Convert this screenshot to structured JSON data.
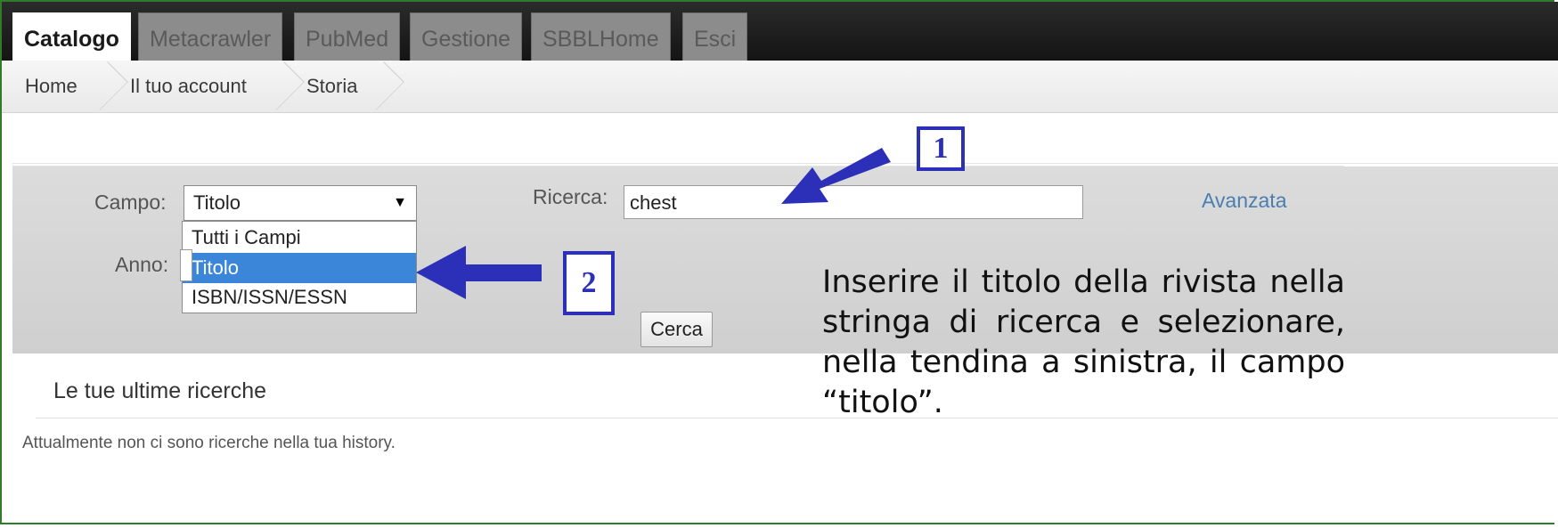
{
  "tabs": [
    {
      "label": "Catalogo",
      "active": true
    },
    {
      "label": "Metacrawler",
      "active": false
    },
    {
      "label": "PubMed",
      "active": false
    },
    {
      "label": "Gestione",
      "active": false
    },
    {
      "label": "SBBLHome",
      "active": false
    },
    {
      "label": "Esci",
      "active": false
    }
  ],
  "breadcrumb": [
    "Home",
    "Il tuo account",
    "Storia"
  ],
  "search": {
    "campo_label": "Campo:",
    "campo_value": "Titolo",
    "options": [
      "Tutti i Campi",
      "Titolo",
      "ISBN/ISSN/ESSN"
    ],
    "selected_option": "Titolo",
    "anno_label": "Anno:",
    "ricerca_label": "Ricerca:",
    "ricerca_value": "chest",
    "advanced_link": "Avanzata",
    "submit_label": "Cerca"
  },
  "history": {
    "title": "Le tue ultime ricerche",
    "message": "Attualmente non ci sono ricerche nella tua history."
  },
  "annotations": {
    "callout_1": "1",
    "callout_2": "2",
    "instruction": "Inserire il titolo della rivista nella stringa di ricerca e selezionare, nella tendina a sinistra, il campo “titolo”.",
    "arrow_color": "#2c2fb8"
  },
  "colors": {
    "frame_border": "#2f7d2b",
    "selected_option_bg": "#3b86d8",
    "link": "#4a7fb0"
  }
}
